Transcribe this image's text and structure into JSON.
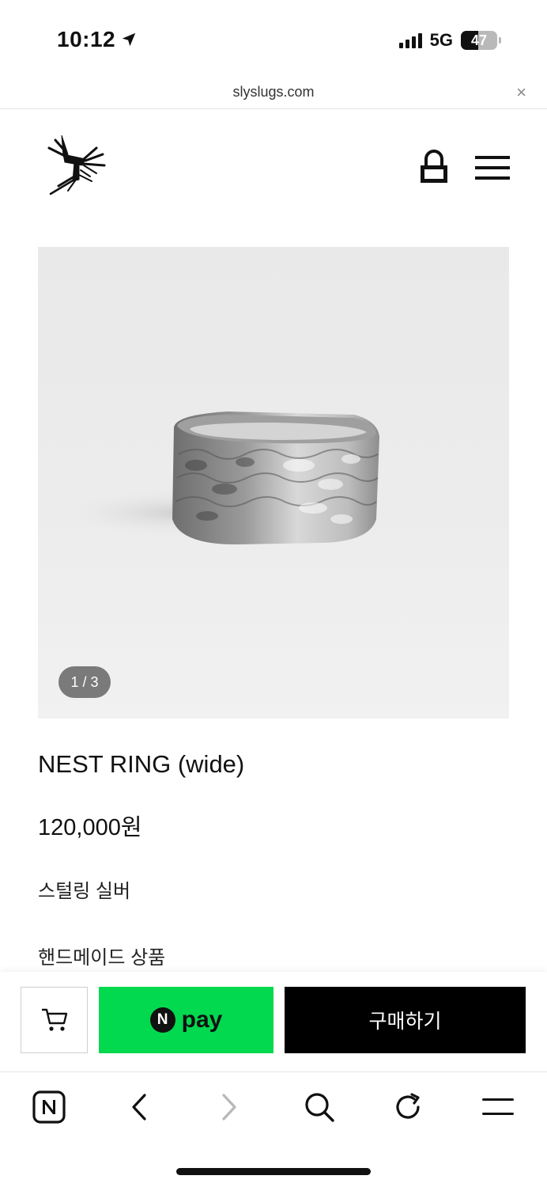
{
  "status_bar": {
    "time": "10:12",
    "network": "5G",
    "battery": "47",
    "battery_level": 0.47,
    "icons": [
      "location-arrow-icon",
      "signal-icon",
      "battery-icon"
    ]
  },
  "browser": {
    "url": "slyslugs.com",
    "close_label": "×"
  },
  "header": {
    "icons": [
      "logo",
      "lock-icon",
      "menu-icon"
    ]
  },
  "product": {
    "image_counter": "1 / 3",
    "title": "NEST RING (wide)",
    "price": "120,000원",
    "material": "스털링 실버",
    "note": "핸드메이드 상품"
  },
  "purchase": {
    "npay_badge": "N",
    "npay_label": "pay",
    "buy_label": "구매하기",
    "colors": {
      "npay": "#03d94f",
      "buy": "#000000"
    }
  },
  "toolbar": {
    "icons": [
      "naver-home-icon",
      "back-icon",
      "forward-icon",
      "search-icon",
      "refresh-icon",
      "menu-icon"
    ]
  }
}
